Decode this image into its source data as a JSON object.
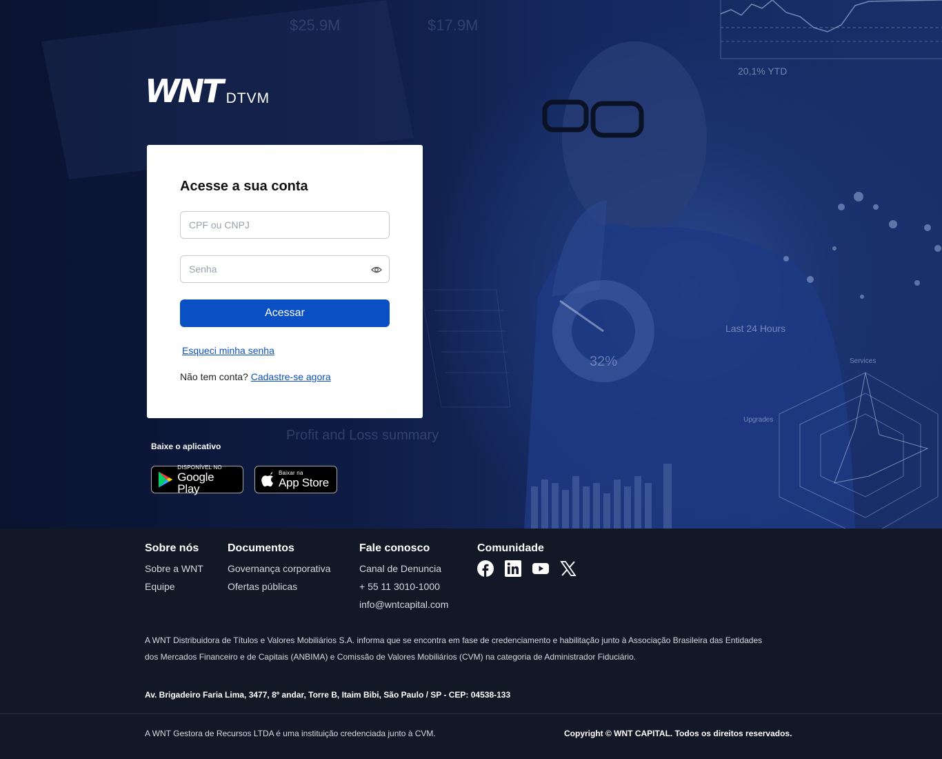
{
  "brand": {
    "mark": "WNT",
    "sub": "DTVM"
  },
  "login": {
    "title": "Acesse a sua conta",
    "document_placeholder": "CPF ou CNPJ",
    "password_placeholder": "Senha",
    "submit_label": "Acessar",
    "forgot_label": "Esqueci minha senha",
    "no_account_text": "Não tem conta?",
    "signup_label": "Cadastre-se agora"
  },
  "apps": {
    "label": "Baixe o aplicativo",
    "google_small": "DISPONÍVEL NO",
    "google_big": "Google Play",
    "apple_small": "Baixar na",
    "apple_big": "App Store"
  },
  "hero_bg": {
    "texts": [
      "$25.9M",
      "$17.9M",
      "20,1% YTD",
      "Last 24 Hours",
      "32%",
      "Profit and Loss summary",
      "Services",
      "Upgrades"
    ]
  },
  "footer": {
    "columns": [
      {
        "title": "Sobre nós",
        "links": [
          "Sobre a WNT",
          "Equipe"
        ]
      },
      {
        "title": "Documentos",
        "links": [
          "Governança corporativa",
          "Ofertas públicas"
        ]
      },
      {
        "title": "Fale conosco",
        "links": [
          "Canal de Denuncia",
          "+ 55 11 3010-1000",
          "info@wntcapital.com"
        ]
      },
      {
        "title": "Comunidade",
        "social": [
          "facebook-icon",
          "linkedin-icon",
          "youtube-icon",
          "x-icon"
        ]
      }
    ],
    "disclaimer": "A WNT Distribuidora de Títulos e Valores Mobiliários S.A. informa que se encontra em fase de credenciamento e habilitação junto à Associação Brasileira das Entidades dos Mercados Financeiro e de Capitais (ANBIMA) e Comissão de Valores Mobiliários (CVM) na categoria de Administrador Fiduciário.",
    "address": "Av. Brigadeiro Faria Lima, 3477, 8º andar, Torre B, Itaim Bibi, São Paulo / SP - CEP: 04538-133",
    "legal_left": "A WNT Gestora de Recursos LTDA é uma instituição credenciada junto à CVM.",
    "copyright": "Copyright © WNT CAPITAL. Todos os direitos reservados."
  },
  "colors": {
    "primary": "#0b4fc4",
    "footer_bg": "#121826",
    "hero_dark": "#0a1330"
  }
}
